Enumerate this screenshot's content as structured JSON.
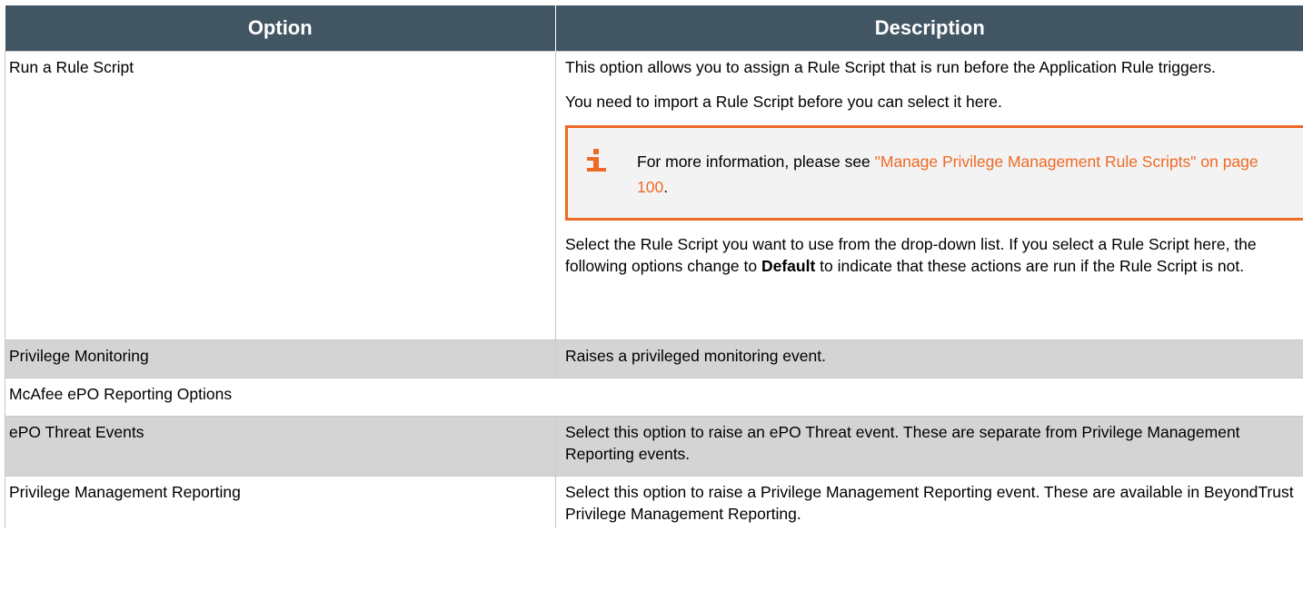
{
  "header": {
    "option": "Option",
    "description": "Description"
  },
  "rows": {
    "rule_script": {
      "option": "Run a Rule Script",
      "p1": "This option allows you to assign a Rule Script that is run before the Application Rule triggers.",
      "p2": "You need to import a Rule Script before you can select it here.",
      "note": {
        "prefix": "For more information, please see ",
        "link": "\"Manage Privilege Management Rule Scripts\" on page 100",
        "suffix": "."
      },
      "p3_before": "Select the Rule Script you want to use from the drop-down list. If you select a Rule Script here, the following options change to ",
      "p3_bold": "Default",
      "p3_after": " to indicate that these actions are run if the Rule Script is not."
    },
    "privilege_monitoring": {
      "option": "Privilege Monitoring",
      "description": "Raises a privileged monitoring event."
    },
    "mcafee": {
      "option": "McAfee ePO Reporting Options"
    },
    "epo_threat": {
      "option": "ePO Threat Events",
      "description": "Select this option to raise an ePO Threat event. These are separate from Privilege Management Reporting events."
    },
    "pm_reporting": {
      "option": "Privilege Management Reporting",
      "description": "Select this option to raise a Privilege Management Reporting event. These are available in BeyondTrust Privilege Management Reporting."
    }
  },
  "colors": {
    "header_bg": "#425563",
    "accent": "#ee6a27",
    "row_grey": "#d4d4d4",
    "note_bg": "#f3f3f3"
  },
  "icons": {
    "note": "info-icon"
  }
}
